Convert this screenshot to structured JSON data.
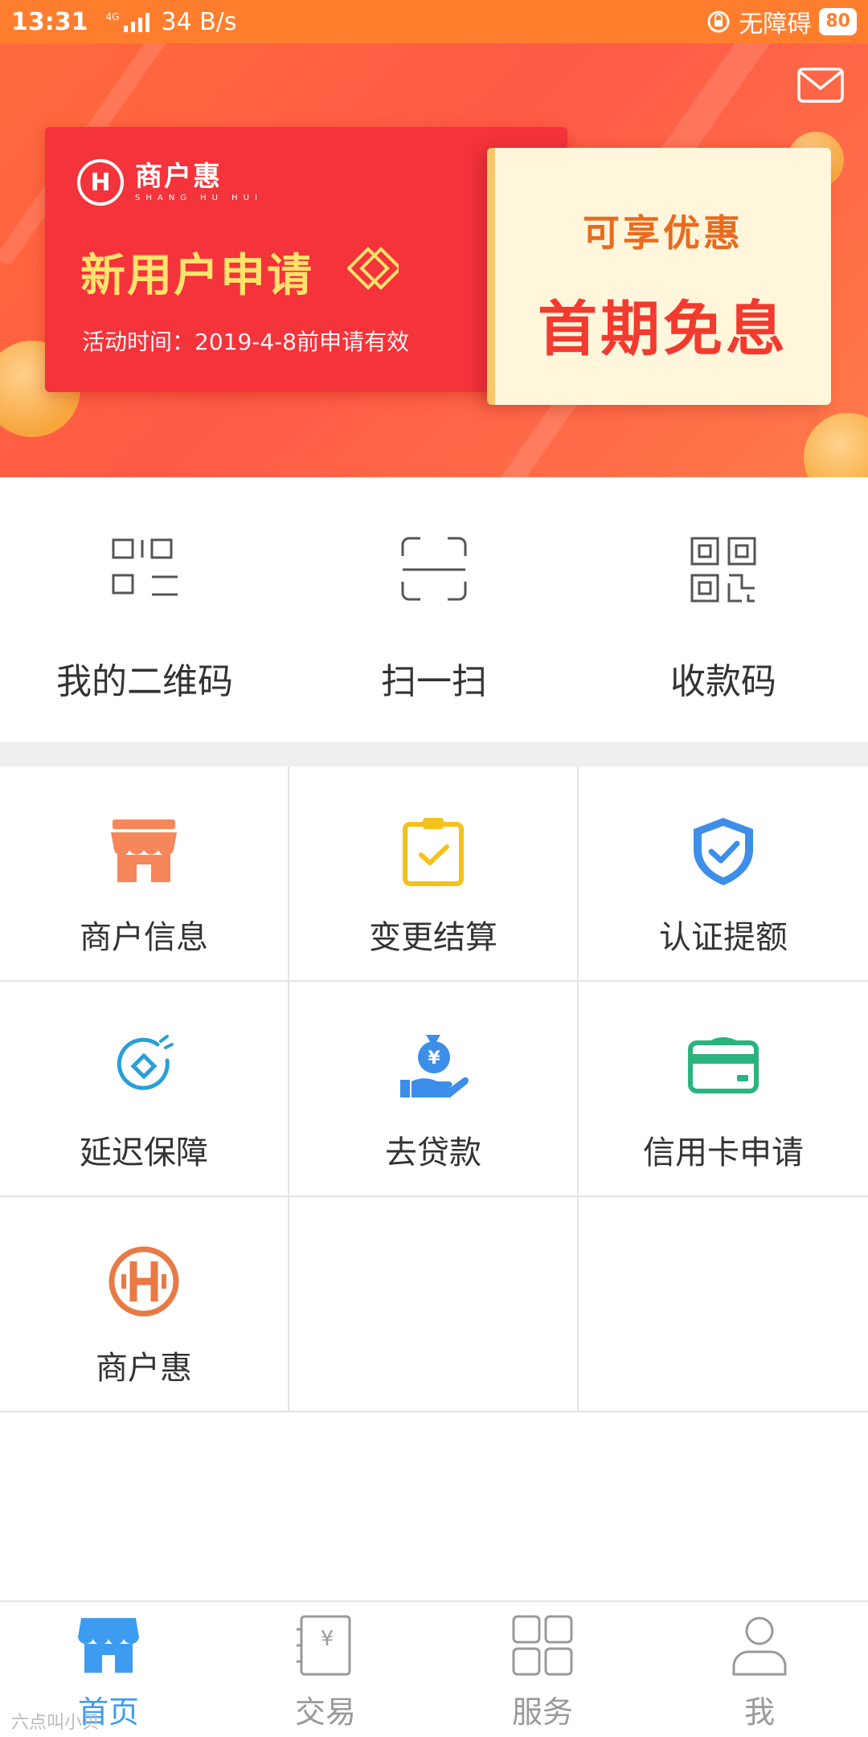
{
  "status_bar": {
    "time": "13:31",
    "network": "4G",
    "speed": "34 B/s",
    "accessibility": "无障碍",
    "battery": "80"
  },
  "banner": {
    "brand": "商户惠",
    "brand_sub": "SHANG HU HUI",
    "title": "新用户申请",
    "date_text": "活动时间：2019-4-8前申请有效",
    "offer_top": "可享优惠",
    "offer_bottom": "首期免息",
    "mail_icon": "mail-icon"
  },
  "quick_actions": [
    {
      "label": "我的二维码",
      "icon": "my-qrcode-icon"
    },
    {
      "label": "扫一扫",
      "icon": "scan-icon"
    },
    {
      "label": "收款码",
      "icon": "payment-qrcode-icon"
    }
  ],
  "services": [
    {
      "label": "商户信息",
      "icon": "store-icon",
      "color": "#f5875a"
    },
    {
      "label": "变更结算",
      "icon": "clipboard-check-icon",
      "color": "#f5c21b"
    },
    {
      "label": "认证提额",
      "icon": "shield-check-icon",
      "color": "#3d8ee8"
    },
    {
      "label": "延迟保障",
      "icon": "delay-guarantee-icon",
      "color": "#2a9fd6"
    },
    {
      "label": "去贷款",
      "icon": "loan-money-bag-icon",
      "color": "#3d8ee8"
    },
    {
      "label": "信用卡申请",
      "icon": "credit-card-icon",
      "color": "#2bb37e"
    },
    {
      "label": "商户惠",
      "icon": "shanghuhui-logo-icon",
      "color": "#e87a45"
    }
  ],
  "bottom_nav": [
    {
      "label": "首页",
      "icon": "home-store-icon",
      "active": true
    },
    {
      "label": "交易",
      "icon": "transaction-icon",
      "active": false
    },
    {
      "label": "服务",
      "icon": "services-grid-icon",
      "active": false
    },
    {
      "label": "我",
      "icon": "profile-icon",
      "active": false
    }
  ],
  "watermark": "六点叫小贝"
}
